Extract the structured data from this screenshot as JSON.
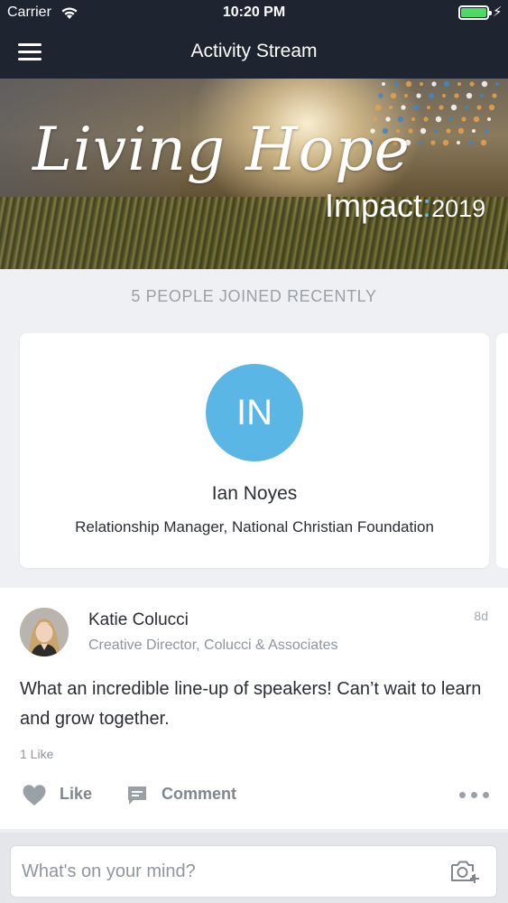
{
  "status_bar": {
    "carrier": "Carrier",
    "time": "10:20 PM",
    "battery_level": 1.0
  },
  "nav": {
    "title": "Activity Stream",
    "menu_icon": "hamburger-menu-icon"
  },
  "banner": {
    "script_text": "Living Hope",
    "impact_word": "Impact",
    "impact_colon": ":",
    "impact_year": "2019"
  },
  "joined": {
    "heading": "5 PEOPLE JOINED RECENTLY",
    "people": [
      {
        "initials": "IN",
        "name": "Ian Noyes",
        "title": "Relationship Manager, National Christian Foundation",
        "avatar_color": "#5ab6e4"
      }
    ]
  },
  "post": {
    "author": "Katie Colucci",
    "role": "Creative Director, Colucci & Associates",
    "time": "8d",
    "body": "What an incredible line-up of speakers! Can’t wait to learn and grow together.",
    "likes": "1 Like",
    "like_label": "Like",
    "comment_label": "Comment"
  },
  "composer": {
    "placeholder": "What's on your mind?",
    "camera_icon": "add-photo-camera-icon"
  },
  "colors": {
    "nav_bg": "#1f2530",
    "accent_blue": "#5ab6e4",
    "banner_dot_orange": "#e8a24a",
    "banner_dot_blue": "#3f86c6",
    "battery_green": "#4cd964"
  }
}
